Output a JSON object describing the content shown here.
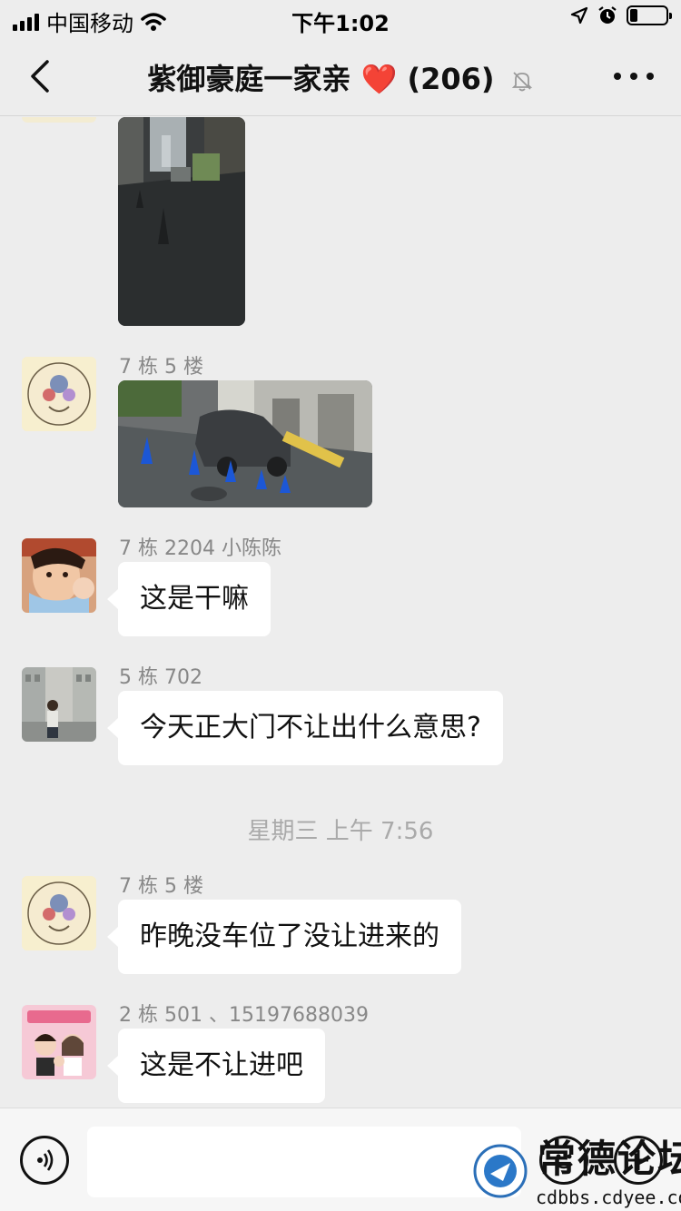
{
  "status_bar": {
    "carrier": "中国移动",
    "time": "下午1:02",
    "battery_level": 0.2
  },
  "nav": {
    "title": "紫御豪庭一家亲",
    "heart": "❤️",
    "member_count": "(206)"
  },
  "messages": [
    {
      "type": "image",
      "sender": "",
      "description_icon": "street-photo"
    },
    {
      "type": "image",
      "sender": "7 栋 5 楼",
      "description_icon": "car-photo"
    },
    {
      "type": "text",
      "sender": "7 栋 2204 小陈陈",
      "text": "这是干嘛"
    },
    {
      "type": "text",
      "sender": "5 栋 702",
      "text": "今天正大门不让出什么意思?"
    },
    {
      "type": "text",
      "sender": "7 栋 5 楼",
      "text": "昨晚没车位了没让进来的"
    },
    {
      "type": "text",
      "sender": "2 栋 501 、15197688039",
      "text": "这是不让进吧"
    }
  ],
  "time_divider": "星期三 上午 7:56",
  "input": {
    "placeholder": ""
  },
  "watermark": {
    "text": "常德论坛",
    "url": "cdbbs.cdyee.com"
  },
  "colors": {
    "background": "#ededed",
    "bubble": "#ffffff",
    "heart": "#e0201e"
  }
}
